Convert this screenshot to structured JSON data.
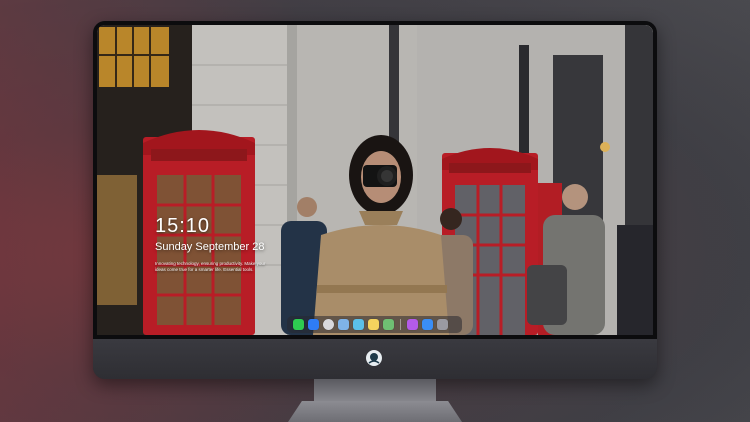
{
  "lock_screen": {
    "time": "15:10",
    "date": "Sunday September 28",
    "quote": "Innovating technology, ensuring productivity. Make your ideas come true for a smarter life. Essential tools."
  },
  "dock": {
    "items": [
      {
        "name": "messages-icon",
        "color": "#2ecc51"
      },
      {
        "name": "finder-icon",
        "color": "#2e7cf6"
      },
      {
        "name": "settings-icon",
        "color": "#d8d8dc"
      },
      {
        "name": "files-icon",
        "color": "#7fb3e8"
      },
      {
        "name": "video-icon",
        "color": "#5bc0e8"
      },
      {
        "name": "notes-icon",
        "color": "#f4d35e"
      },
      {
        "name": "photos-icon",
        "color": "#6fbf73"
      },
      {
        "name": "music-icon",
        "color": "#b45be8"
      },
      {
        "name": "app-store-icon",
        "color": "#3a8ef6"
      },
      {
        "name": "camera-icon",
        "color": "#9a9aa2"
      }
    ]
  },
  "colors": {
    "phone_box_red": "#c8202a",
    "coat_tan": "#b89a72"
  }
}
